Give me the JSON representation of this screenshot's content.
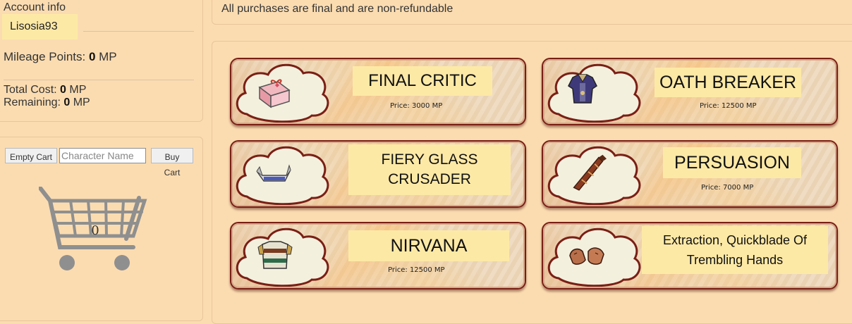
{
  "account": {
    "title": "Account info",
    "username": "Lisosia93",
    "mileage_label": "Mileage Points: ",
    "mileage_value": "0",
    "mileage_unit": " MP",
    "total_label": "Total Cost: ",
    "total_value": "0",
    "total_unit": " MP",
    "remaining_label": "Remaining: ",
    "remaining_value": "0",
    "remaining_unit": " MP"
  },
  "cart": {
    "empty_label": "Empty Cart",
    "character_placeholder": "Character Name",
    "buy_label": "Buy Cart",
    "count": "0"
  },
  "notice": "All purchases are final and are non-refundable",
  "items": [
    {
      "name": "FINAL CRITIC",
      "price": "Price: 3000 MP",
      "icon": "gift-box-icon"
    },
    {
      "name": "OATH BREAKER",
      "price": "Price: 12500 MP",
      "icon": "armor-icon"
    },
    {
      "name": "FIERY GLASS CRUSADER",
      "price": "",
      "icon": "belt-icon"
    },
    {
      "name": "PERSUASION",
      "price": "Price: 7000 MP",
      "icon": "scabbard-icon"
    },
    {
      "name": "NIRVANA",
      "price": "Price: 12500 MP",
      "icon": "robe-icon"
    },
    {
      "name": "Extraction, Quickblade Of Trembling Hands",
      "price": "",
      "icon": "gloves-icon"
    }
  ],
  "colors": {
    "background": "#fbdcb1",
    "highlight": "#fde9a6",
    "card_border": "#7a1f15",
    "cloud_fill": "#f3f0de"
  }
}
